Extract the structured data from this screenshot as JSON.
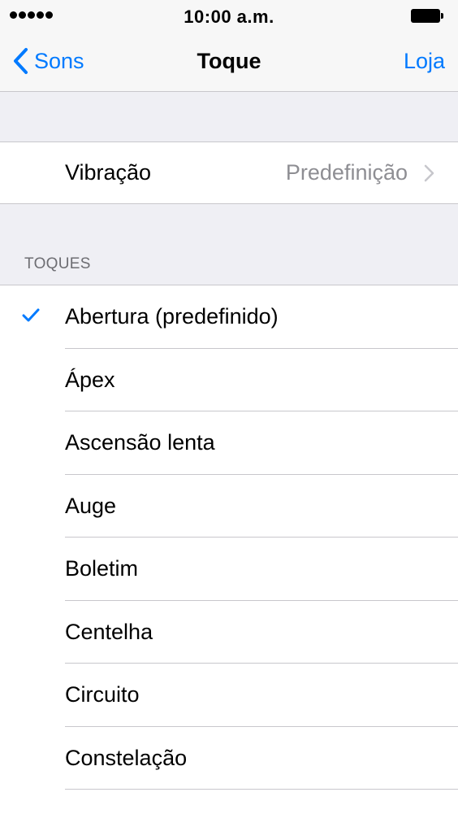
{
  "status_bar": {
    "time": "10:00 a.m.",
    "signal_icon": "signal-dots-icon",
    "battery_icon": "battery-icon"
  },
  "nav": {
    "back_label": "Sons",
    "title": "Toque",
    "right_label": "Loja",
    "accent_color": "#007aff"
  },
  "vibration": {
    "label": "Vibração",
    "value": "Predefinição"
  },
  "section": {
    "header": "TOQUES"
  },
  "ringtones": [
    {
      "name": "Abertura (predefinido)",
      "selected": true
    },
    {
      "name": "Ápex",
      "selected": false
    },
    {
      "name": "Ascensão lenta",
      "selected": false
    },
    {
      "name": "Auge",
      "selected": false
    },
    {
      "name": "Boletim",
      "selected": false
    },
    {
      "name": "Centelha",
      "selected": false
    },
    {
      "name": "Circuito",
      "selected": false
    },
    {
      "name": "Constelação",
      "selected": false
    }
  ]
}
